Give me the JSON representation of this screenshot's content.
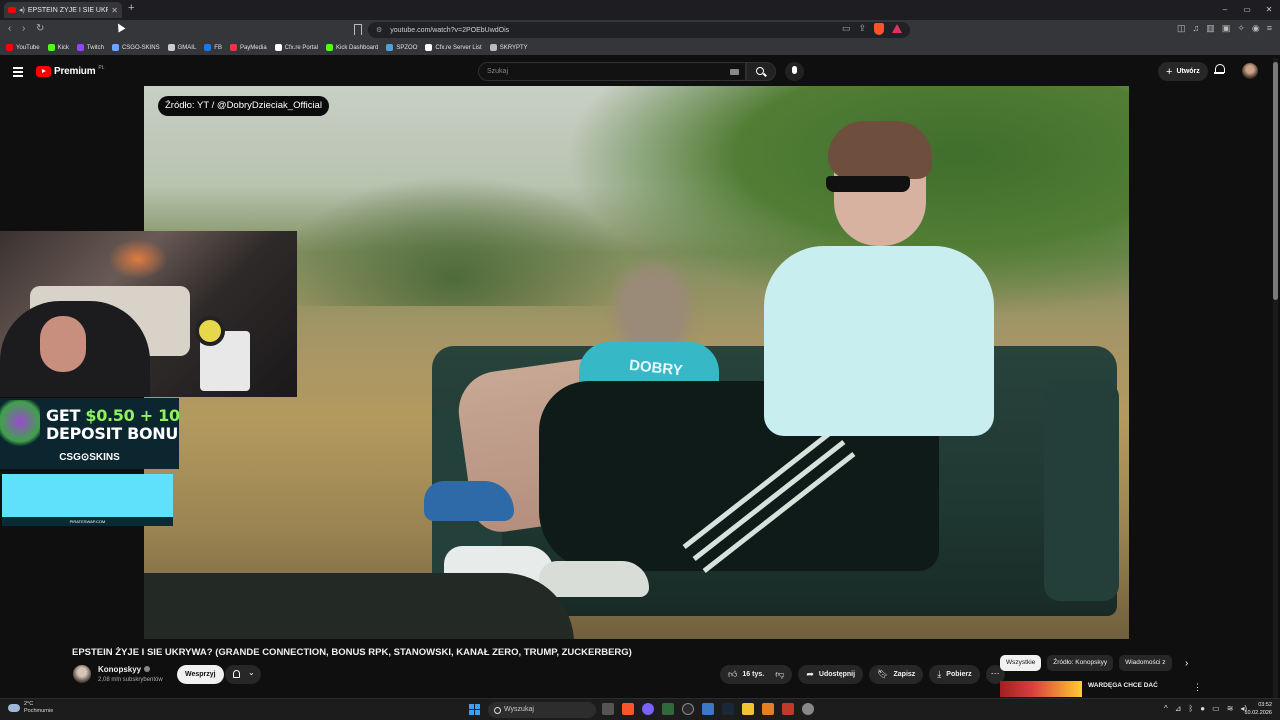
{
  "browser": {
    "tab_title": "EPSTEIN ŻYJE I SIE UKRYWA?",
    "url": "youtube.com/watch?v=2POEbUwdOis",
    "new_tab": "+",
    "window_controls": [
      "–",
      "▭",
      "✕"
    ]
  },
  "bookmarks": [
    {
      "label": "YouTube",
      "color": "#ff0000"
    },
    {
      "label": "Kick",
      "color": "#53fc18"
    },
    {
      "label": "Twitch",
      "color": "#9146ff"
    },
    {
      "label": "CSGO-SKINS",
      "color": "#6aa7ff"
    },
    {
      "label": "GMAIL",
      "color": "#cccccc"
    },
    {
      "label": "FB",
      "color": "#1877f2"
    },
    {
      "label": "PayMedia",
      "color": "#e63946"
    },
    {
      "label": "Cfx.re Portal",
      "color": "#ffffff"
    },
    {
      "label": "Kick Dashboard",
      "color": "#53fc18"
    },
    {
      "label": "SPZOO",
      "color": "#4aa3df"
    },
    {
      "label": "Cfx.re Server List",
      "color": "#ffffff"
    },
    {
      "label": "SKRYPTY",
      "color": "#bbbbbb"
    }
  ],
  "youtube": {
    "logo_text": "Premium",
    "logo_region": "PL",
    "search_placeholder": "Szukaj",
    "create_label": "Utwórz"
  },
  "video": {
    "source_label": "Źródło: YT / @DobryDzieciak_Official",
    "shirt_text": "DOBRY",
    "title": "EPSTEIN ŻYJE I SIE UKRYWA? (GRANDE CONNECTION, BONUS RPK, STANOWSKI, KANAŁ ZERO, TRUMP, ZUCKERBERG)"
  },
  "overlay": {
    "promo_line1_prefix": "GET ",
    "promo_amount": "$0.50 + 10",
    "promo_line2": "DEPOSIT BONU",
    "promo_brand": "CSG⊙SKINS",
    "cyan_footer": "PIRATESWAP.COM"
  },
  "channel": {
    "name": "Konopskyy",
    "subscribers": "2,08 mln subskrybentów",
    "support_label": "Wesprzyj"
  },
  "actions": {
    "likes": "16 tys.",
    "share": "Udostępnij",
    "save": "Zapisz",
    "download": "Pobierz"
  },
  "chips": [
    "Wszystkie",
    "Źródło: Konopskyy",
    "Wiadomości z"
  ],
  "recommendation": {
    "title": "WARDĘGA CHCE DAĆ"
  },
  "taskbar": {
    "weather_temp": "2°C",
    "weather_desc": "Pochmurnie",
    "search_label": "Wyszukaj",
    "time": "03:52",
    "date": "10.02.2026"
  }
}
